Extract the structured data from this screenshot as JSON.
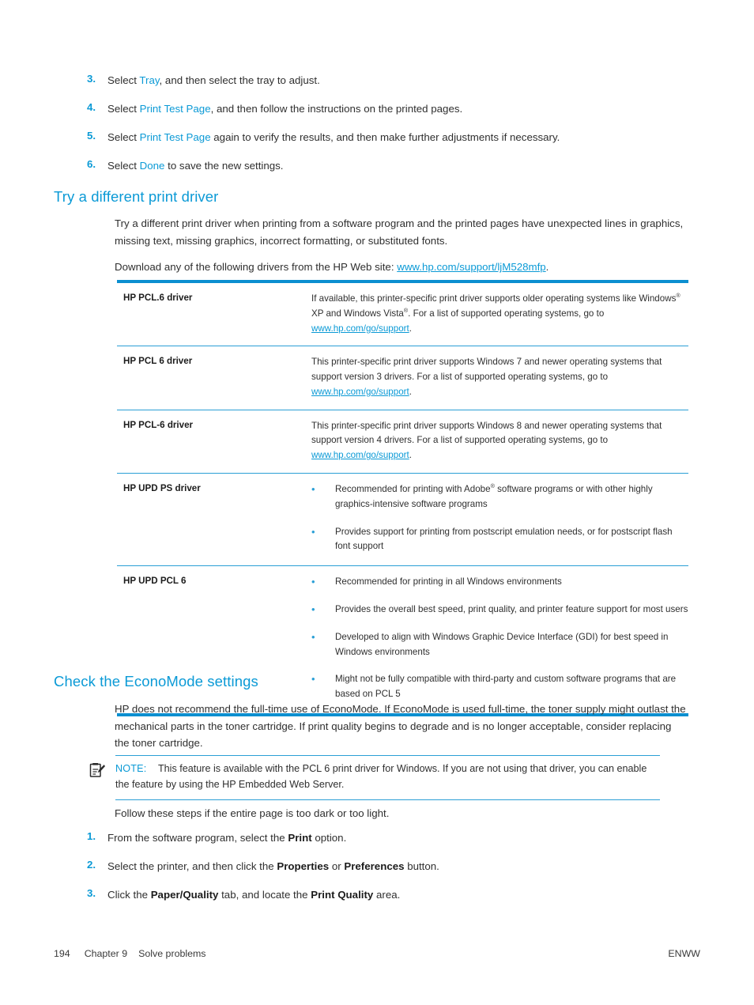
{
  "steps_top": [
    {
      "num": "3.",
      "parts": [
        {
          "t": "Select ",
          "s": "plain"
        },
        {
          "t": "Tray",
          "s": "accent"
        },
        {
          "t": ", and then select the tray to adjust.",
          "s": "plain"
        }
      ]
    },
    {
      "num": "4.",
      "parts": [
        {
          "t": "Select ",
          "s": "plain"
        },
        {
          "t": "Print Test Page",
          "s": "accent"
        },
        {
          "t": ", and then follow the instructions on the printed pages.",
          "s": "plain"
        }
      ]
    },
    {
      "num": "5.",
      "parts": [
        {
          "t": "Select ",
          "s": "plain"
        },
        {
          "t": "Print Test Page",
          "s": "accent"
        },
        {
          "t": " again to verify the results, and then make further adjustments if necessary.",
          "s": "plain"
        }
      ]
    },
    {
      "num": "6.",
      "parts": [
        {
          "t": "Select ",
          "s": "plain"
        },
        {
          "t": "Done",
          "s": "accent"
        },
        {
          "t": " to save the new settings.",
          "s": "plain"
        }
      ]
    }
  ],
  "driver_section": {
    "heading": "Try a different print driver",
    "paragraph": "Try a different print driver when printing from a software program and the printed pages have unexpected lines in graphics, missing text, missing graphics, incorrect formatting, or substituted fonts.",
    "download_lead": "Download any of the following drivers from the HP Web site: ",
    "download_link": "www.hp.com/support/ljM528mfp",
    "download_tail": "."
  },
  "driver_table": {
    "rows": [
      {
        "name": "HP PCL.6 driver",
        "type": "paragraph",
        "text_before": "If available, this printer-specific print driver supports older operating systems like Windows",
        "sup1": "®",
        "text_mid": " XP and Windows Vista",
        "sup2": "®",
        "text_after": ". For a list of supported operating systems, go to ",
        "link": "www.hp.com/go/support",
        "text_end": "."
      },
      {
        "name": "HP PCL 6 driver",
        "type": "paragraph",
        "text_before": "This printer-specific print driver supports Windows 7 and newer operating systems that support version 3 drivers. For a list of supported operating systems, go to ",
        "sup1": "",
        "text_mid": "",
        "sup2": "",
        "text_after": "",
        "link": "www.hp.com/go/support",
        "text_end": "."
      },
      {
        "name": "HP PCL-6 driver",
        "type": "paragraph",
        "text_before": "This printer-specific print driver supports Windows 8 and newer operating systems that support version 4 drivers. For a list of supported operating systems, go to ",
        "sup1": "",
        "text_mid": "",
        "sup2": "",
        "text_after": "",
        "link": "www.hp.com/go/support",
        "text_end": "."
      },
      {
        "name": "HP UPD PS driver",
        "type": "bullets",
        "bullets": [
          {
            "before": "Recommended for printing with Adobe",
            "sup": "®",
            "after": " software programs or with other highly graphics-intensive software programs"
          },
          {
            "before": "Provides support for printing from postscript emulation needs, or for postscript flash font support",
            "sup": "",
            "after": ""
          }
        ]
      },
      {
        "name": "HP UPD PCL 6",
        "type": "bullets",
        "bullets": [
          {
            "before": "Recommended for printing in all Windows environments",
            "sup": "",
            "after": ""
          },
          {
            "before": "Provides the overall best speed, print quality, and printer feature support for most users",
            "sup": "",
            "after": ""
          },
          {
            "before": "Developed to align with Windows Graphic Device Interface (GDI) for best speed in Windows environments",
            "sup": "",
            "after": ""
          },
          {
            "before": "Might not be fully compatible with third-party and custom software programs that are based on PCL 5",
            "sup": "",
            "after": ""
          }
        ]
      }
    ]
  },
  "econo_section": {
    "heading": "Check the EconoMode settings",
    "paragraph": "HP does not recommend the full-time use of EconoMode. If EconoMode is used full-time, the toner supply might outlast the mechanical parts in the toner cartridge. If print quality begins to degrade and is no longer acceptable, consider replacing the toner cartridge.",
    "note_label": "NOTE:",
    "note_text": "This feature is available with the PCL 6 print driver for Windows. If you are not using that driver, you can enable the feature by using the HP Embedded Web Server.",
    "note_icon": "note-clipboard-pencil-icon",
    "follow_text": "Follow these steps if the entire page is too dark or too light."
  },
  "steps_bottom": [
    {
      "num": "1.",
      "parts": [
        {
          "t": "From the software program, select the ",
          "s": "plain"
        },
        {
          "t": "Print",
          "s": "bold"
        },
        {
          "t": " option.",
          "s": "plain"
        }
      ]
    },
    {
      "num": "2.",
      "parts": [
        {
          "t": "Select the printer, and then click the ",
          "s": "plain"
        },
        {
          "t": "Properties",
          "s": "bold"
        },
        {
          "t": " or ",
          "s": "plain"
        },
        {
          "t": "Preferences",
          "s": "bold"
        },
        {
          "t": " button.",
          "s": "plain"
        }
      ]
    },
    {
      "num": "3.",
      "parts": [
        {
          "t": "Click the ",
          "s": "plain"
        },
        {
          "t": "Paper/Quality",
          "s": "bold"
        },
        {
          "t": " tab, and locate the ",
          "s": "plain"
        },
        {
          "t": "Print Quality",
          "s": "bold"
        },
        {
          "t": " area.",
          "s": "plain"
        }
      ]
    }
  ],
  "footer": {
    "page_number": "194",
    "chapter": "Chapter 9",
    "chapter_title": "Solve problems",
    "locale": "ENWW"
  },
  "colors": {
    "accent": "#0b9ad6",
    "rule": "#2b9fd6",
    "rule_thick": "#0b8fd0",
    "text": "#2f2f2f"
  }
}
